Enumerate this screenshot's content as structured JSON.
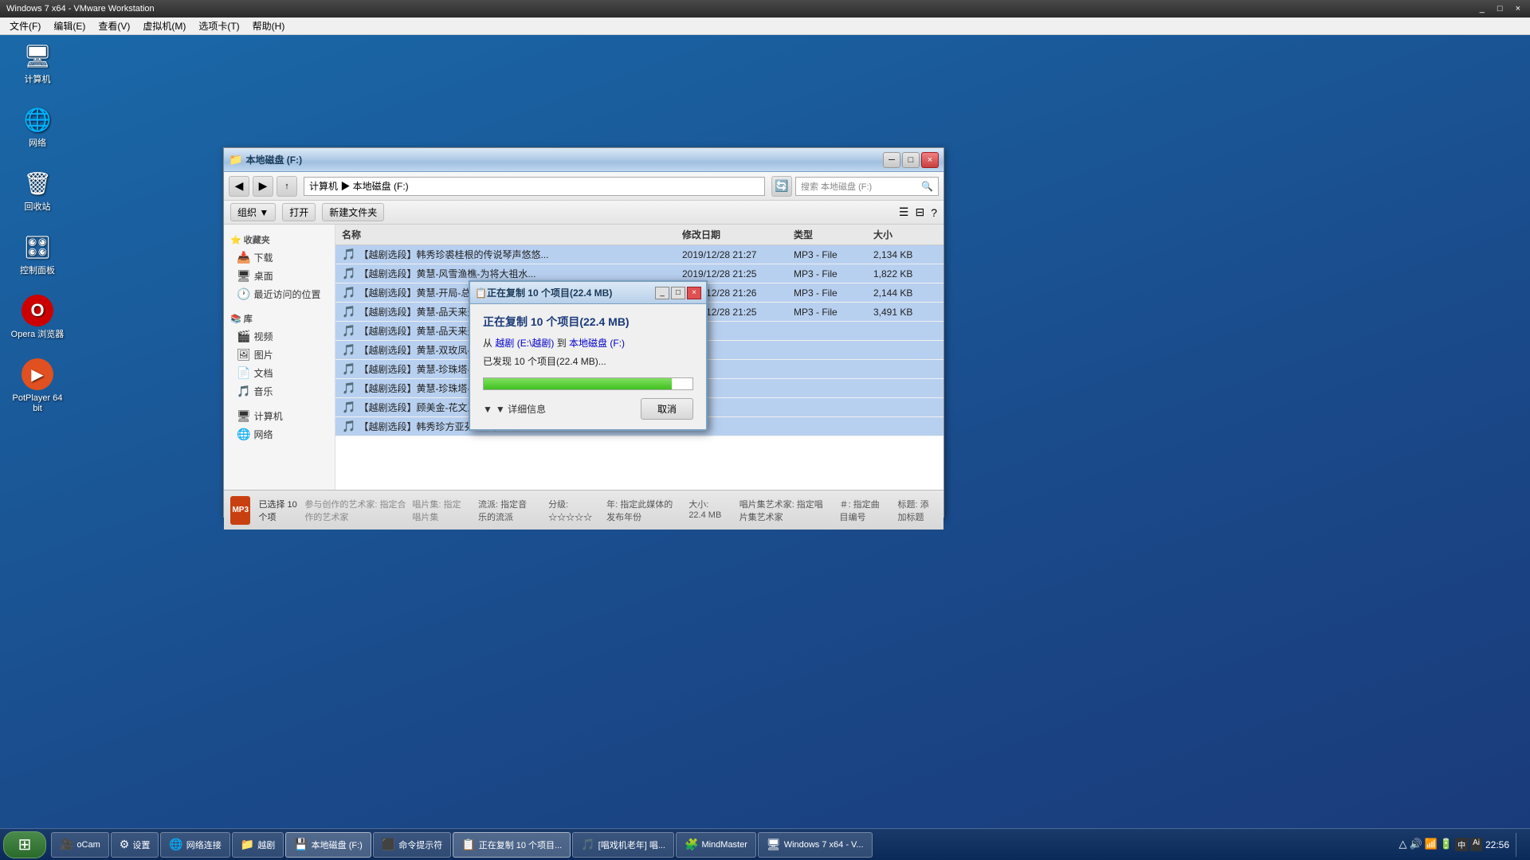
{
  "vmware": {
    "titlebar": "Windows 7 x64 - VMware Workstation",
    "menus": [
      "文件(F)",
      "编辑(E)",
      "查看(V)",
      "虚拟机(M)",
      "选项卡(T)",
      "帮助(H)"
    ],
    "controls": [
      "_",
      "□",
      "×"
    ]
  },
  "desktop_icons": [
    {
      "id": "computer",
      "label": "计算机",
      "icon": "🖥"
    },
    {
      "id": "network",
      "label": "网络",
      "icon": "🌐"
    },
    {
      "id": "recycle",
      "label": "回收站",
      "icon": "🗑"
    },
    {
      "id": "controlpanel",
      "label": "控制面板",
      "icon": "🎛"
    },
    {
      "id": "opera",
      "label": "Opera 浏览器",
      "icon": "O"
    },
    {
      "id": "potplayer",
      "label": "PotPlayer 64 bit",
      "icon": "▶"
    }
  ],
  "explorer": {
    "title": "本地磁盘 (F:)",
    "address": "计算机 ▶ 本地磁盘 (F:)",
    "search_placeholder": "搜索 本地磁盘 (F:)",
    "toolbar_btns": [
      "组织 ▼",
      "打开",
      "新建文件夹"
    ],
    "columns": [
      "名称",
      "修改日期",
      "类型",
      "大小"
    ],
    "files": [
      {
        "name": "【越剧选段】韩秀珍裘桂根的传说琴声悠悠...",
        "date": "2019/12/28 21:27",
        "type": "MP3 - File",
        "size": "2,134 KB"
      },
      {
        "name": "【越剧选段】黄慧-风雪渔樵-为将大祖水...",
        "date": "2019/12/28 21:25",
        "type": "MP3 - File",
        "size": "1,822 KB"
      },
      {
        "name": "【越剧选段】黄慧-开局-总理回韩应笑娘",
        "date": "2019/12/28 21:26",
        "type": "MP3 - File",
        "size": "2,144 KB"
      },
      {
        "name": "【越剧选段】黄慧-品天来天天-夹本楼",
        "date": "2019/12/28 21:25",
        "type": "MP3 - File",
        "size": "3,491 KB"
      },
      {
        "name": "【越剧选段】黄慧-品天来天失体征值...",
        "date": "",
        "type": "",
        "size": ""
      },
      {
        "name": "【越剧选段】黄慧-双玫凤-送花探...",
        "date": "",
        "type": "",
        "size": ""
      },
      {
        "name": "【越剧选段】黄慧-珍珠塔-递通情...",
        "date": "",
        "type": "",
        "size": ""
      },
      {
        "name": "【越剧选段】黄慧-珍珠塔-君子受用...",
        "date": "",
        "type": "",
        "size": ""
      },
      {
        "name": "【越剧选段】顾美金-花文王龙王在过...",
        "date": "",
        "type": "",
        "size": ""
      },
      {
        "name": "【越剧选段】韩秀珍方亚芬裘桂根的传...",
        "date": "",
        "type": "",
        "size": ""
      }
    ],
    "sidebar": {
      "favorites": "收藏夹",
      "fav_items": [
        "下载",
        "桌面",
        "最近访问的位置"
      ],
      "library": "库",
      "lib_items": [
        "视频",
        "图片",
        "文档",
        "音乐"
      ],
      "computer": "计算机",
      "network": "网络"
    },
    "status": {
      "selected": "已选择 10 个项",
      "artist": "参与创作的艺术家: 指定合作的艺术家",
      "album": "唱片集: 指定唱片集",
      "source": "流派: 指定音乐的流派",
      "rating": "分级: ☆☆☆☆☆",
      "year": "年: 指定此媒体的发布年份",
      "size": "大小: 22.4 MB",
      "disc": "唱片集艺术家: 指定唱片集艺术家",
      "track": "＃: 指定曲目编号",
      "tags": "标题: 添加标题"
    }
  },
  "copy_dialog": {
    "title": "正在复制 10 个项目(22.4 MB)",
    "main_title": "正在复制 10 个项目(22.4 MB)",
    "from_label": "从 越剧",
    "from_path": "(E:\\越剧)",
    "to_label": "到 本地磁盘 (F:)",
    "progress_text": "已发现 10 个项目(22.4 MB)...",
    "progress_percent": 90,
    "details_label": "▼ 详细信息",
    "cancel_label": "取消"
  },
  "taskbar": {
    "start_icon": "⊞",
    "buttons": [
      {
        "id": "ocam",
        "label": "oCam",
        "icon": "🎥"
      },
      {
        "id": "controlpanel2",
        "label": "设置",
        "icon": "⚙"
      },
      {
        "id": "netconnect",
        "label": "网络连接",
        "icon": "🌐"
      },
      {
        "id": "yuejiu",
        "label": "越剧",
        "icon": "📁"
      },
      {
        "id": "localdisk",
        "label": "本地磁盘 (F:)",
        "icon": "💾",
        "active": true
      },
      {
        "id": "cmd",
        "label": "命令提示符",
        "icon": "⬛"
      },
      {
        "id": "copying",
        "label": "正在复制 10 个项目...",
        "icon": "📋",
        "active": true
      },
      {
        "id": "singclub",
        "label": "[唱戏机老年] 唱...",
        "icon": "🎵"
      },
      {
        "id": "mindmaster",
        "label": "MindMaster",
        "icon": "🧩"
      },
      {
        "id": "win7vm",
        "label": "Windows 7 x64 - V...",
        "icon": "🖥"
      }
    ],
    "tray": {
      "icons": [
        "△",
        "🔊",
        "📶",
        "🔋"
      ],
      "time": "22:56",
      "date": ""
    }
  }
}
